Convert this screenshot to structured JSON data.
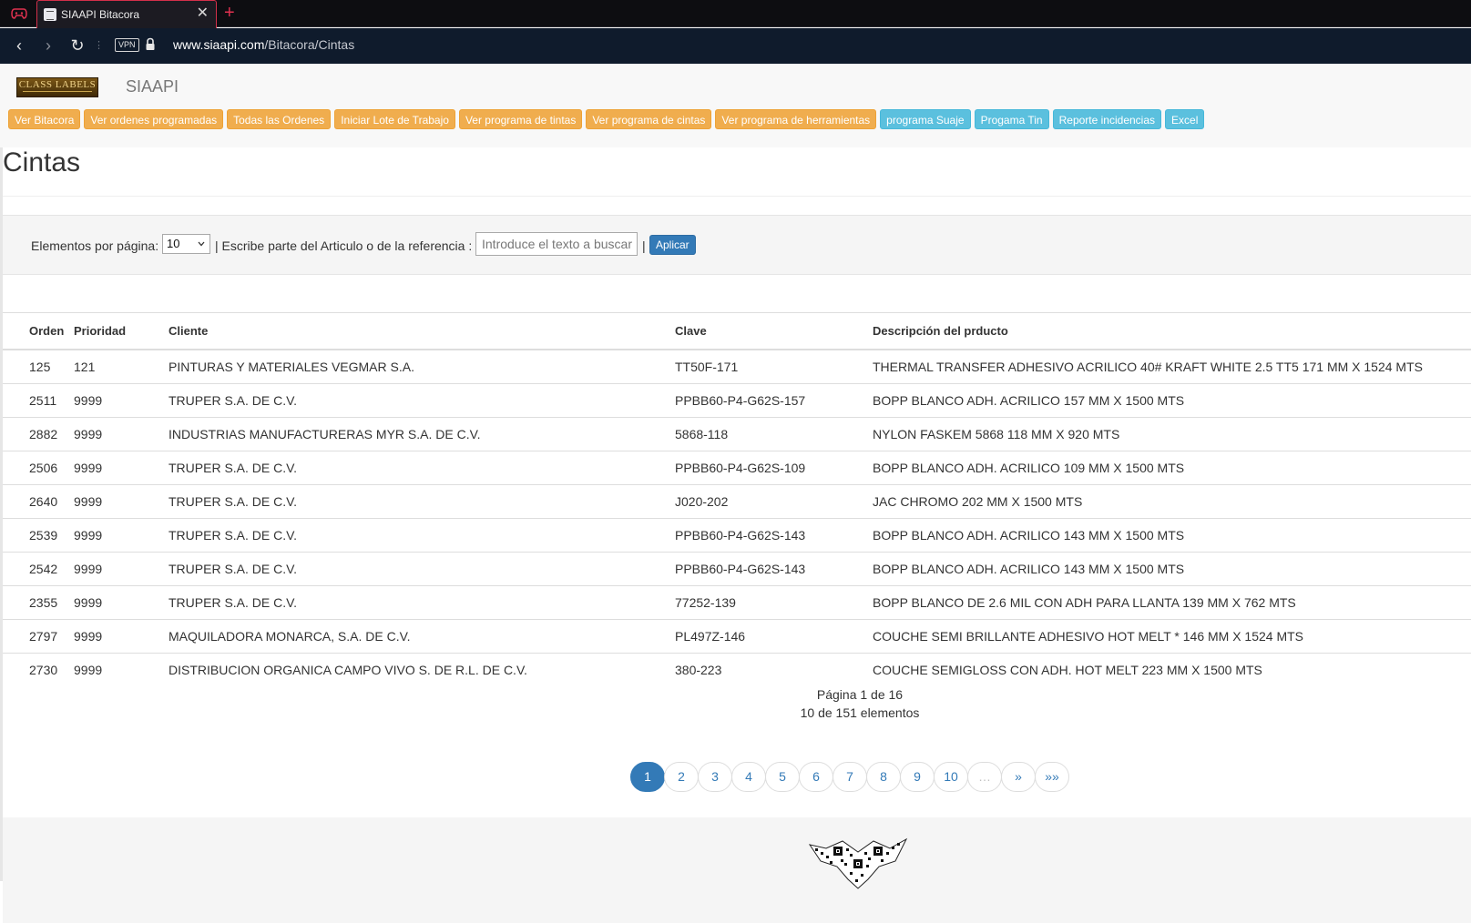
{
  "browser": {
    "tab_title": "SIAAPI Bitacora",
    "url_host": "www.siaapi.com",
    "url_path": "/Bitacora/Cintas",
    "vpn_label": "VPN"
  },
  "header": {
    "brand_logo_text": "CLASS LABELS",
    "brand_name": "SIAAPI"
  },
  "menu": [
    {
      "label": "Ver Bitacora",
      "style": "warning"
    },
    {
      "label": "Ver ordenes programadas",
      "style": "warning"
    },
    {
      "label": "Todas las Ordenes",
      "style": "warning"
    },
    {
      "label": "Iniciar Lote de Trabajo",
      "style": "warning"
    },
    {
      "label": "Ver programa de tintas",
      "style": "warning"
    },
    {
      "label": "Ver programa de cintas",
      "style": "warning"
    },
    {
      "label": "Ver programa de herramientas",
      "style": "warning"
    },
    {
      "label": "programa Suaje",
      "style": "info"
    },
    {
      "label": "Progama Tin",
      "style": "info"
    },
    {
      "label": "Reporte incidencias",
      "style": "info"
    },
    {
      "label": "Excel",
      "style": "info"
    }
  ],
  "colors": {
    "warning": "#f0ad4e",
    "info": "#5bc0de",
    "primary": "#337ab7"
  },
  "page": {
    "title": "Cintas"
  },
  "filter": {
    "per_page_label": "Elementos por página:",
    "per_page_value": "10",
    "search_label": "| Escribe parte del Articulo o de la referencia :",
    "search_placeholder": "Introduce el texto a buscar",
    "separator": "|",
    "apply_label": "Aplicar"
  },
  "table": {
    "headers": [
      "Orden",
      "Prioridad",
      "Cliente",
      "Clave",
      "Descripción del prducto"
    ],
    "rows": [
      [
        "125",
        "121",
        "PINTURAS Y MATERIALES VEGMAR S.A.",
        "TT50F-171",
        "THERMAL  TRANSFER  ADHESIVO ACRILICO  40# KRAFT WHITE 2.5 TT5 171 MM X 1524 MTS"
      ],
      [
        "2511",
        "9999",
        "TRUPER S.A. DE C.V.",
        "PPBB60-P4-G62S-157",
        "BOPP BLANCO ADH. ACRILICO 157 MM X 1500 MTS"
      ],
      [
        "2882",
        "9999",
        "INDUSTRIAS MANUFACTURERAS MYR S.A. DE C.V.",
        "5868-118",
        "NYLON FASKEM 5868 118 MM X 920 MTS"
      ],
      [
        "2506",
        "9999",
        "TRUPER S.A. DE C.V.",
        "PPBB60-P4-G62S-109",
        "BOPP BLANCO ADH. ACRILICO 109 MM X 1500 MTS"
      ],
      [
        "2640",
        "9999",
        "TRUPER S.A. DE C.V.",
        "J020-202",
        "JAC CHROMO 202 MM X 1500 MTS"
      ],
      [
        "2539",
        "9999",
        "TRUPER S.A. DE C.V.",
        "PPBB60-P4-G62S-143",
        "BOPP BLANCO ADH. ACRILICO 143 MM X 1500 MTS"
      ],
      [
        "2542",
        "9999",
        "TRUPER S.A. DE C.V.",
        "PPBB60-P4-G62S-143",
        "BOPP BLANCO ADH. ACRILICO 143 MM X 1500 MTS"
      ],
      [
        "2355",
        "9999",
        "TRUPER S.A. DE C.V.",
        "77252-139",
        "BOPP BLANCO DE 2.6 MIL CON ADH PARA LLANTA 139 MM X 762 MTS"
      ],
      [
        "2797",
        "9999",
        "MAQUILADORA MONARCA, S.A. DE C.V.",
        "PL497Z-146",
        "COUCHE SEMI BRILLANTE  ADHESIVO HOT MELT * 146 MM X 1524 MTS"
      ],
      [
        "2730",
        "9999",
        "DISTRIBUCION ORGANICA CAMPO VIVO S. DE R.L. DE C.V.",
        "380-223",
        "COUCHE SEMIGLOSS CON ADH. HOT MELT 223 MM X 1500 MTS"
      ]
    ]
  },
  "pager": {
    "page_text": "Página 1 de 16",
    "count_text": "10 de 151 elementos",
    "pages": [
      {
        "label": "1",
        "state": "active"
      },
      {
        "label": "2",
        "state": "normal"
      },
      {
        "label": "3",
        "state": "normal"
      },
      {
        "label": "4",
        "state": "normal"
      },
      {
        "label": "5",
        "state": "normal"
      },
      {
        "label": "6",
        "state": "normal"
      },
      {
        "label": "7",
        "state": "normal"
      },
      {
        "label": "8",
        "state": "normal"
      },
      {
        "label": "9",
        "state": "normal"
      },
      {
        "label": "10",
        "state": "normal"
      },
      {
        "label": "…",
        "state": "disabled"
      },
      {
        "label": "»",
        "state": "normal"
      },
      {
        "label": "»»",
        "state": "normal"
      }
    ]
  }
}
